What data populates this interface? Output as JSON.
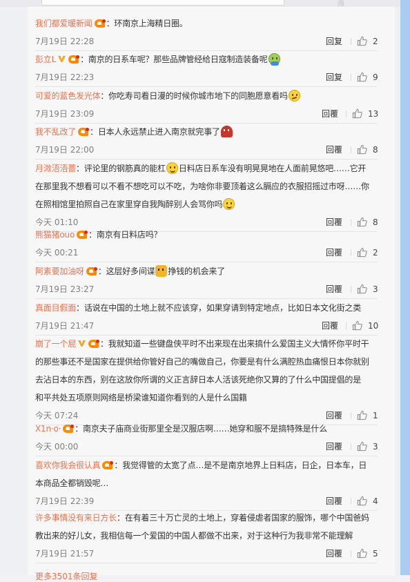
{
  "top_hint": "海",
  "comments": [
    {
      "user": "我们都爱暖新闻",
      "has_v": false,
      "badge": true,
      "segments": [
        {
          "t": "：环南京上海精日圈。"
        }
      ],
      "time": "7月19日 22:28",
      "reply": "回复",
      "likes": "2"
    },
    {
      "user": "彭立L",
      "has_v": true,
      "badge": true,
      "segments": [
        {
          "t": "：南京的日系车呢？那些品牌管经给日寇制造装备呢"
        },
        {
          "emoji": "puke-icon"
        }
      ],
      "time": "7月19日 22:23",
      "reply": "回复",
      "likes": "9"
    },
    {
      "user": "可爱的蓝色发光体",
      "has_v": false,
      "badge": false,
      "segments": [
        {
          "t": "：你吃寿司看日漫的时候你城市地下的同胞愿意看吗"
        },
        {
          "emoji": "think-icon"
        }
      ],
      "time": "7月19日 23:09",
      "reply": "回覆",
      "likes": "13"
    },
    {
      "user": "我不乱改了",
      "has_v": false,
      "badge": true,
      "segments": [
        {
          "t": "：日本人永远禁止进入南京就完事了"
        },
        {
          "emoji": "soldier-icon"
        }
      ],
      "time": "7月19日 22:00",
      "reply": "回覆",
      "likes": "8"
    },
    {
      "user": "月溦浯浯薔",
      "has_v": false,
      "badge": false,
      "segments": [
        {
          "t": "：评论里的钢筋真的能杠"
        },
        {
          "emoji": "smile-icon"
        },
        {
          "t": "日料店日系车没有明晃晃地在人面前晃悠吧……它开"
        }
      ],
      "extra_lines": [
        "在那里我不想看可以不看不想吃可以不吃，为啥你非要顶着这么膈应的衣服招摇过市呀……你",
        [
          {
            "t": "在照相馆里拍照自己在家里穿自我陶醉别人会骂你吗"
          },
          {
            "emoji": "grin-icon"
          }
        ]
      ],
      "time": "今天 01:10",
      "reply": "回覆",
      "likes": "8"
    },
    {
      "user": "熊猫猪ouo",
      "has_v": false,
      "badge": true,
      "segments": [
        {
          "t": "：南京有日料店吗？"
        }
      ],
      "time": "今天 00:21",
      "reply": "回覆",
      "likes": "2"
    },
    {
      "user": "阿素要加油呀",
      "has_v": false,
      "badge": true,
      "segments": [
        {
          "t": "：这层好多间谍"
        },
        {
          "emoji": "tiger-icon"
        },
        {
          "t": "挣钱的机会来了"
        }
      ],
      "time": "7月19日 23:27",
      "reply": "回覆",
      "likes": "3"
    },
    {
      "user": "真面目假面",
      "has_v": false,
      "badge": false,
      "segments": [
        {
          "t": "：话说在中国的土地上就不应该穿，如果穿请到特定地点，比如日本文化街之类"
        }
      ],
      "time": "7月19日 21:47",
      "reply": "回覆",
      "likes": "10"
    },
    {
      "user": "崩了一个屁",
      "has_v": true,
      "badge": true,
      "segments": [
        {
          "t": "：我就知道一些键盘侠平时不出来现在出来搞什么爱国主义大情怀你平时干"
        }
      ],
      "extra_lines": [
        "的那些事还不是国家在提供给你管好自己的嘴做自己，你要是有什么满腔热血痛恨日本你就别",
        "去沾日本的东西，别在这放你所谓的义正言辞日本人活该死绝你又算的了什么中国提倡的是",
        "和平共处五项原则网络是桥梁谁知道你看到的人是什么国籍"
      ],
      "time": "今天 07:24",
      "reply": "回覆",
      "likes": "1"
    },
    {
      "user": "X1n·o·",
      "has_v": false,
      "badge": true,
      "segments": [
        {
          "t": "：南京夫子庙商业街那里全是汉服店啊……她穿和服不是搞特殊是什么"
        }
      ],
      "time": "今天 00:00",
      "reply": "回覆",
      "likes": "3"
    },
    {
      "user": "喜欢你我会很认真",
      "has_v": false,
      "badge": true,
      "segments": [
        {
          "t": "：我觉得管的太宽了点…是不是南京地界上日料店，日企，日本车，日"
        }
      ],
      "extra_lines": [
        "本商品全都销毁呢…"
      ],
      "time": "7月19日 22:39",
      "reply": "回覆",
      "likes": "4"
    },
    {
      "user": "许多事情没有来日方长",
      "has_v": false,
      "badge": false,
      "segments": [
        {
          "t": "：在有着三十万亡灵的土地上，穿着侵虐者国家的服饰，哪个中国爸妈"
        }
      ],
      "extra_lines": [
        "教出来的好儿女，我相信每一个爱国的中国人都做不出来，对于这种行为我非常不能理解"
      ],
      "time": "7月19日 21:57",
      "reply": "回覆",
      "likes": "5"
    }
  ],
  "more_link": "更多3501条回复"
}
